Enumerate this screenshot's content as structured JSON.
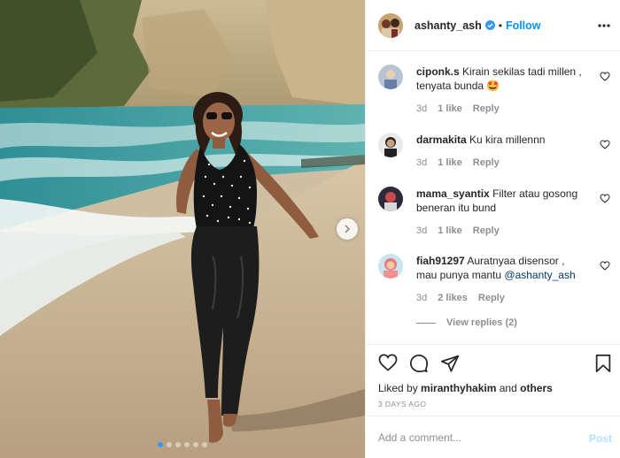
{
  "header": {
    "username": "ashanty_ash",
    "separator": "•",
    "follow_label": "Follow",
    "verified_icon": "verified-badge-icon",
    "more_icon": "more-options-icon"
  },
  "comments": [
    {
      "username": "ciponk.s",
      "text": "Kirain sekilas tadi millen , tenyata bunda 🤩",
      "time": "3d",
      "likes": "1 like",
      "reply": "Reply"
    },
    {
      "username": "darmakita",
      "text": "Ku kira millennn",
      "time": "3d",
      "likes": "1 like",
      "reply": "Reply"
    },
    {
      "username": "mama_syantix",
      "text": "Filter atau gosong beneran itu bund",
      "time": "3d",
      "likes": "1 like",
      "reply": "Reply"
    },
    {
      "username": "fiah91297",
      "text_before": "Auratnyaa disensor , mau punya mantu ",
      "mention": "@ashanty_ash",
      "time": "3d",
      "likes": "2 likes",
      "reply": "Reply"
    }
  ],
  "view_replies": "View replies (2)",
  "actions": {
    "icons": [
      "heart-icon",
      "comment-icon",
      "share-icon",
      "bookmark-icon"
    ],
    "liked_by_prefix": "Liked by",
    "liked_by_user": "miranthyhakim",
    "liked_by_and": "and",
    "liked_by_others": "others",
    "time_ago": "3 DAYS AGO"
  },
  "add_comment": {
    "placeholder": "Add a comment...",
    "post_label": "Post"
  },
  "carousel": {
    "slide_count": 6,
    "active_slide": 1
  },
  "colors": {
    "accent": "#0095f6",
    "post_disabled": "#b2dffc",
    "active_dot": "#3797f0"
  }
}
